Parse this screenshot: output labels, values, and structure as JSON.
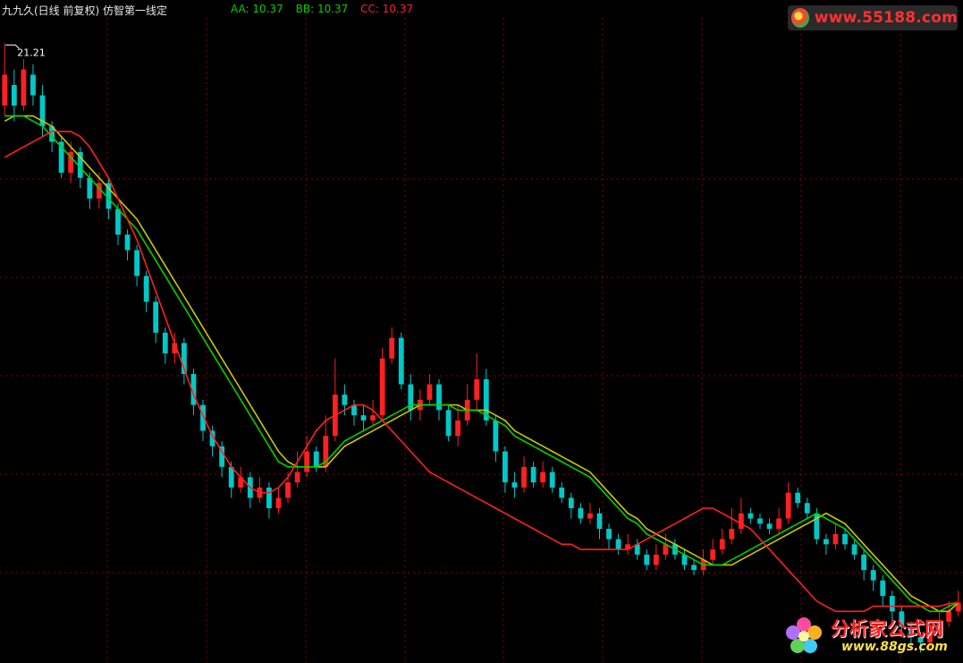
{
  "header": {
    "title": "九九久(日线 前复权) 仿智第一线定",
    "indicators": [
      {
        "label": "AA:",
        "value": "10.37",
        "color": "#00d000"
      },
      {
        "label": "BB:",
        "value": "10.37",
        "color": "#00d000"
      },
      {
        "label": "CC:",
        "value": "10.37",
        "color": "#ff2020"
      }
    ]
  },
  "logos": {
    "top_url": "www.55188.com",
    "bottom_name": "分析家公式网",
    "bottom_url": "www.88gs.com"
  },
  "colors": {
    "background": "#000000",
    "grid": "#8b0000",
    "up": "#ff2020",
    "down": "#00c8c8",
    "aa_line": "#00d000",
    "bb_line": "#c8c800",
    "cc_line": "#ff2020",
    "high_marker": "#ffffff"
  },
  "chart_data": {
    "type": "candlestick",
    "high_marker_label": "21.21",
    "y_axis_visible": false,
    "grid": true,
    "ylim": [
      9.2,
      21.7
    ],
    "candles": [
      [
        20.0,
        20.6,
        21.21,
        19.8
      ],
      [
        20.4,
        20.0,
        20.7,
        19.7
      ],
      [
        20.0,
        20.7,
        20.9,
        19.9
      ],
      [
        20.6,
        20.2,
        20.8,
        20.0
      ],
      [
        20.2,
        19.6,
        20.4,
        19.4
      ],
      [
        19.6,
        19.3,
        19.7,
        19.1
      ],
      [
        19.3,
        18.7,
        19.4,
        18.6
      ],
      [
        18.7,
        19.1,
        19.3,
        18.5
      ],
      [
        19.1,
        18.6,
        19.2,
        18.4
      ],
      [
        18.6,
        18.2,
        18.7,
        18.0
      ],
      [
        18.2,
        18.5,
        18.7,
        18.0
      ],
      [
        18.5,
        18.0,
        18.6,
        17.8
      ],
      [
        18.0,
        17.5,
        18.1,
        17.3
      ],
      [
        17.5,
        17.2,
        17.6,
        17.0
      ],
      [
        17.2,
        16.7,
        17.3,
        16.5
      ],
      [
        16.7,
        16.2,
        16.8,
        16.0
      ],
      [
        16.2,
        15.6,
        16.3,
        15.4
      ],
      [
        15.6,
        15.2,
        15.7,
        15.0
      ],
      [
        15.2,
        15.4,
        15.6,
        15.0
      ],
      [
        15.4,
        14.8,
        15.5,
        14.6
      ],
      [
        14.8,
        14.2,
        14.9,
        14.0
      ],
      [
        14.2,
        13.7,
        14.3,
        13.5
      ],
      [
        13.7,
        13.4,
        13.8,
        13.2
      ],
      [
        13.4,
        13.0,
        13.5,
        12.8
      ],
      [
        13.0,
        12.6,
        13.1,
        12.4
      ],
      [
        12.6,
        12.8,
        13.0,
        12.5
      ],
      [
        12.8,
        12.4,
        12.9,
        12.2
      ],
      [
        12.4,
        12.6,
        12.8,
        12.3
      ],
      [
        12.6,
        12.2,
        12.7,
        12.0
      ],
      [
        12.2,
        12.4,
        12.6,
        12.1
      ],
      [
        12.4,
        12.7,
        12.9,
        12.3
      ],
      [
        12.7,
        12.9,
        13.3,
        12.6
      ],
      [
        12.9,
        13.3,
        13.6,
        12.8
      ],
      [
        13.3,
        13.0,
        13.4,
        12.9
      ],
      [
        13.0,
        13.6,
        14.0,
        12.9
      ],
      [
        13.6,
        14.4,
        15.1,
        13.5
      ],
      [
        14.4,
        14.2,
        14.6,
        14.0
      ],
      [
        14.2,
        14.0,
        14.3,
        13.8
      ],
      [
        14.0,
        13.9,
        14.2,
        13.7
      ],
      [
        13.9,
        14.0,
        14.3,
        13.8
      ],
      [
        14.0,
        15.1,
        15.3,
        13.9
      ],
      [
        15.1,
        15.5,
        15.7,
        15.0
      ],
      [
        15.5,
        14.6,
        15.6,
        14.5
      ],
      [
        14.6,
        14.1,
        14.8,
        13.9
      ],
      [
        14.1,
        14.3,
        14.5,
        13.9
      ],
      [
        14.3,
        14.6,
        14.8,
        14.2
      ],
      [
        14.6,
        14.1,
        14.7,
        13.9
      ],
      [
        14.1,
        13.6,
        14.2,
        13.5
      ],
      [
        13.6,
        13.9,
        14.2,
        13.4
      ],
      [
        13.9,
        14.3,
        14.6,
        13.8
      ],
      [
        14.3,
        14.7,
        15.2,
        14.1
      ],
      [
        14.7,
        13.9,
        14.9,
        13.8
      ],
      [
        13.9,
        13.3,
        14.0,
        13.1
      ],
      [
        13.3,
        12.7,
        13.4,
        12.5
      ],
      [
        12.7,
        12.6,
        12.9,
        12.4
      ],
      [
        12.6,
        13.0,
        13.2,
        12.5
      ],
      [
        13.0,
        12.7,
        13.1,
        12.6
      ],
      [
        12.7,
        12.9,
        13.1,
        12.6
      ],
      [
        12.9,
        12.6,
        13.0,
        12.5
      ],
      [
        12.6,
        12.4,
        12.7,
        12.3
      ],
      [
        12.4,
        12.2,
        12.5,
        12.0
      ],
      [
        12.2,
        12.0,
        12.3,
        11.9
      ],
      [
        12.0,
        12.1,
        12.3,
        11.9
      ],
      [
        12.1,
        11.8,
        12.2,
        11.6
      ],
      [
        11.8,
        11.6,
        11.9,
        11.4
      ],
      [
        11.6,
        11.4,
        11.7,
        11.3
      ],
      [
        11.4,
        11.5,
        11.7,
        11.3
      ],
      [
        11.5,
        11.3,
        11.6,
        11.2
      ],
      [
        11.3,
        11.1,
        11.4,
        11.0
      ],
      [
        11.1,
        11.3,
        11.5,
        11.0
      ],
      [
        11.3,
        11.5,
        11.7,
        11.2
      ],
      [
        11.5,
        11.3,
        11.6,
        11.2
      ],
      [
        11.3,
        11.1,
        11.4,
        11.0
      ],
      [
        11.1,
        11.0,
        11.2,
        10.9
      ],
      [
        11.0,
        11.2,
        11.4,
        10.9
      ],
      [
        11.2,
        11.4,
        11.6,
        11.1
      ],
      [
        11.4,
        11.6,
        11.8,
        11.3
      ],
      [
        11.6,
        11.8,
        12.2,
        11.5
      ],
      [
        11.8,
        12.1,
        12.4,
        11.7
      ],
      [
        12.1,
        12.0,
        12.2,
        11.9
      ],
      [
        12.0,
        11.9,
        12.1,
        11.8
      ],
      [
        11.9,
        11.8,
        12.0,
        11.7
      ],
      [
        11.8,
        12.0,
        12.2,
        11.7
      ],
      [
        12.0,
        12.5,
        12.7,
        11.9
      ],
      [
        12.5,
        12.3,
        12.6,
        12.2
      ],
      [
        12.3,
        12.1,
        12.4,
        12.0
      ],
      [
        12.1,
        11.6,
        12.2,
        11.5
      ],
      [
        11.6,
        11.5,
        11.7,
        11.3
      ],
      [
        11.5,
        11.7,
        11.9,
        11.4
      ],
      [
        11.7,
        11.5,
        11.8,
        11.4
      ],
      [
        11.5,
        11.3,
        11.6,
        11.2
      ],
      [
        11.3,
        11.0,
        11.4,
        10.8
      ],
      [
        11.0,
        10.8,
        11.1,
        10.6
      ],
      [
        10.8,
        10.5,
        10.9,
        10.3
      ],
      [
        10.5,
        10.2,
        10.6,
        10.0
      ],
      [
        10.2,
        9.9,
        10.3,
        9.7
      ],
      [
        9.9,
        9.7,
        10.0,
        9.5
      ],
      [
        9.7,
        9.6,
        9.8,
        9.4
      ],
      [
        9.6,
        9.8,
        10.0,
        9.5
      ],
      [
        9.8,
        10.0,
        10.2,
        9.7
      ],
      [
        10.0,
        10.2,
        10.4,
        9.9
      ],
      [
        10.2,
        10.37,
        10.6,
        10.1
      ]
    ],
    "aa": [
      19.8,
      19.8,
      19.8,
      19.7,
      19.6,
      19.4,
      19.2,
      19.0,
      18.8,
      18.6,
      18.4,
      18.2,
      18.0,
      17.8,
      17.6,
      17.3,
      17.0,
      16.7,
      16.4,
      16.1,
      15.8,
      15.5,
      15.2,
      14.9,
      14.6,
      14.3,
      14.0,
      13.7,
      13.4,
      13.1,
      13.0,
      13.0,
      13.0,
      13.0,
      13.1,
      13.3,
      13.5,
      13.6,
      13.7,
      13.8,
      13.9,
      14.0,
      14.1,
      14.2,
      14.2,
      14.2,
      14.2,
      14.2,
      14.1,
      14.1,
      14.1,
      14.0,
      13.9,
      13.8,
      13.6,
      13.5,
      13.4,
      13.3,
      13.2,
      13.1,
      13.0,
      12.9,
      12.8,
      12.6,
      12.4,
      12.2,
      12.0,
      11.9,
      11.7,
      11.6,
      11.5,
      11.4,
      11.3,
      11.2,
      11.1,
      11.1,
      11.1,
      11.2,
      11.3,
      11.4,
      11.5,
      11.6,
      11.7,
      11.8,
      11.9,
      12.0,
      12.1,
      12.0,
      11.9,
      11.8,
      11.6,
      11.4,
      11.2,
      11.0,
      10.8,
      10.6,
      10.4,
      10.3,
      10.2,
      10.2,
      10.3,
      10.37
    ],
    "bb": [
      19.7,
      19.8,
      19.8,
      19.8,
      19.7,
      19.6,
      19.4,
      19.2,
      19.0,
      18.8,
      18.6,
      18.4,
      18.2,
      18.0,
      17.8,
      17.5,
      17.2,
      16.9,
      16.6,
      16.3,
      16.0,
      15.7,
      15.4,
      15.1,
      14.8,
      14.5,
      14.2,
      13.9,
      13.6,
      13.3,
      13.1,
      13.0,
      13.0,
      13.0,
      13.0,
      13.2,
      13.4,
      13.5,
      13.6,
      13.7,
      13.8,
      13.9,
      14.0,
      14.1,
      14.2,
      14.2,
      14.2,
      14.2,
      14.2,
      14.1,
      14.1,
      14.1,
      14.0,
      13.9,
      13.7,
      13.6,
      13.5,
      13.4,
      13.3,
      13.2,
      13.1,
      13.0,
      12.9,
      12.7,
      12.5,
      12.3,
      12.1,
      12.0,
      11.8,
      11.7,
      11.6,
      11.5,
      11.4,
      11.3,
      11.2,
      11.1,
      11.1,
      11.1,
      11.2,
      11.3,
      11.4,
      11.5,
      11.6,
      11.7,
      11.8,
      11.9,
      12.0,
      12.1,
      12.0,
      11.9,
      11.7,
      11.5,
      11.3,
      11.1,
      10.9,
      10.7,
      10.5,
      10.4,
      10.3,
      10.2,
      10.2,
      10.37
    ],
    "cc": [
      19.0,
      19.1,
      19.2,
      19.3,
      19.4,
      19.5,
      19.5,
      19.5,
      19.4,
      19.2,
      18.9,
      18.6,
      18.2,
      17.8,
      17.4,
      16.9,
      16.4,
      15.9,
      15.4,
      14.9,
      14.4,
      14.0,
      13.6,
      13.3,
      13.0,
      12.8,
      12.6,
      12.5,
      12.5,
      12.6,
      12.8,
      13.1,
      13.4,
      13.7,
      13.9,
      14.0,
      14.1,
      14.2,
      14.2,
      14.1,
      13.9,
      13.7,
      13.5,
      13.3,
      13.1,
      12.9,
      12.8,
      12.7,
      12.6,
      12.5,
      12.4,
      12.3,
      12.2,
      12.1,
      12.0,
      11.9,
      11.8,
      11.7,
      11.6,
      11.5,
      11.5,
      11.4,
      11.4,
      11.4,
      11.4,
      11.4,
      11.4,
      11.5,
      11.6,
      11.7,
      11.8,
      11.9,
      12.0,
      12.1,
      12.2,
      12.2,
      12.1,
      12.0,
      11.9,
      11.8,
      11.6,
      11.4,
      11.2,
      11.0,
      10.8,
      10.6,
      10.4,
      10.3,
      10.2,
      10.2,
      10.2,
      10.2,
      10.3,
      10.3,
      10.3,
      10.3,
      10.3,
      10.3,
      10.3,
      10.3,
      10.35,
      10.37
    ]
  }
}
